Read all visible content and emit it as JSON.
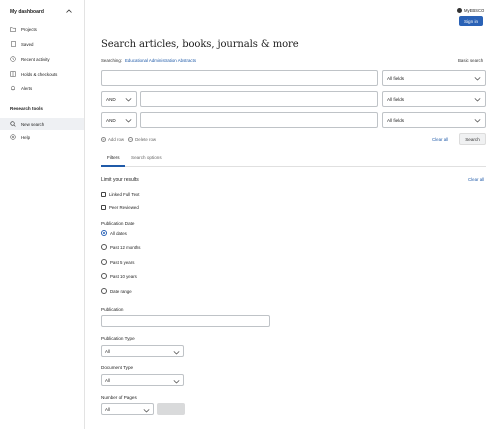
{
  "sidebar": {
    "title": "My dashboard",
    "items": [
      {
        "label": "Projects"
      },
      {
        "label": "Saved"
      },
      {
        "label": "Recent activity"
      },
      {
        "label": "Holds & checkouts"
      },
      {
        "label": "Alerts"
      }
    ],
    "section_title": "Research tools",
    "tools": [
      {
        "label": "New search",
        "active": true
      },
      {
        "label": "Help"
      }
    ]
  },
  "header": {
    "my_ebsco": "MyEBSCO",
    "sign_in": "Sign in"
  },
  "search": {
    "title": "Search articles, books, journals & more",
    "searching_label": "Searching:",
    "database": "Educational Administration Abstracts",
    "basic_search": "Basic search",
    "rows": [
      {
        "field": "All fields",
        "value": ""
      },
      {
        "operator": "AND",
        "field": "All fields",
        "value": ""
      },
      {
        "operator": "AND",
        "field": "All fields",
        "value": ""
      }
    ],
    "add_row": "Add row",
    "delete_row": "Delete row",
    "clear_all": "Clear all",
    "search_button": "Search"
  },
  "tabs": [
    "Filters",
    "Search options"
  ],
  "filters": {
    "limit_title": "Limit your results",
    "clear_all": "Clear all",
    "checkboxes": [
      "Linked Full Text",
      "Peer Reviewed"
    ],
    "publication_date_label": "Publication Date",
    "date_options": [
      "All dates",
      "Past 12 months",
      "Past 5 years",
      "Past 10 years",
      "Date range"
    ],
    "date_selected": "All dates",
    "publication_label": "Publication",
    "publication_value": "",
    "publication_type_label": "Publication Type",
    "publication_type_value": "All",
    "document_type_label": "Document Type",
    "document_type_value": "All",
    "number_of_pages_label": "Number of Pages",
    "number_of_pages_value": "All"
  },
  "colors": {
    "accent": "#2a62b6",
    "link": "#1f5aa8"
  }
}
